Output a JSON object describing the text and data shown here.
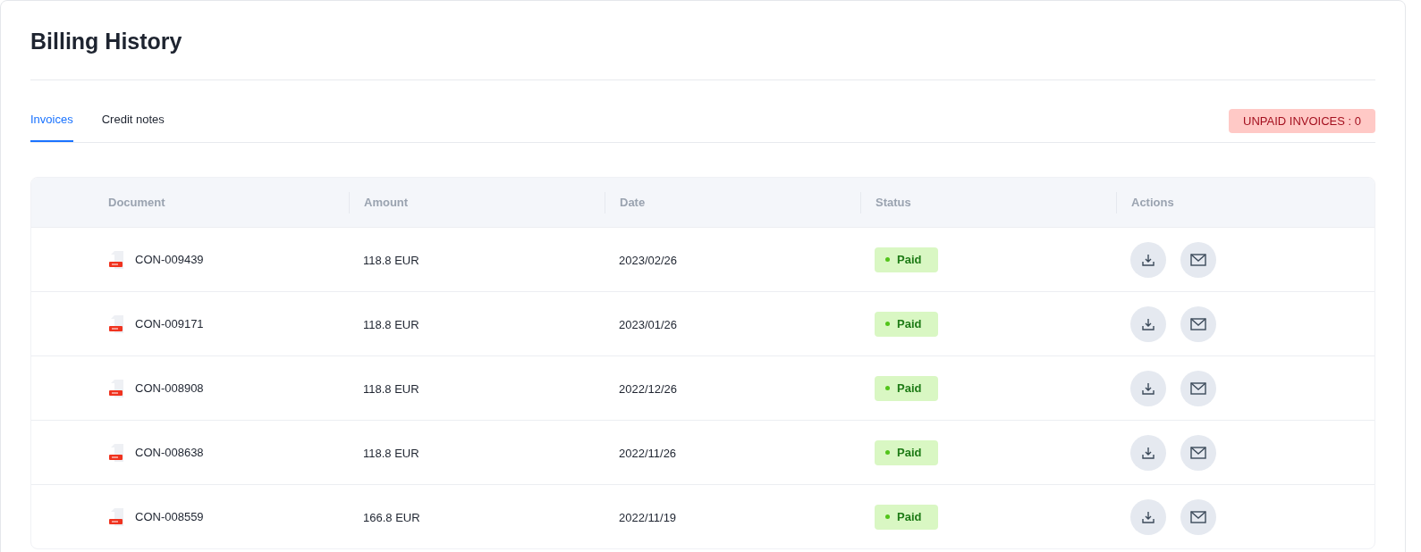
{
  "title": "Billing History",
  "tabs": [
    {
      "label": "Invoices",
      "selected": true
    },
    {
      "label": "Credit notes",
      "selected": false
    }
  ],
  "unpaid_badge": "UNPAID INVOICES : 0",
  "table": {
    "columns": [
      "Document",
      "Amount",
      "Date",
      "Status",
      "Actions"
    ],
    "rows": [
      {
        "document": "CON-009439",
        "amount": "118.8 EUR",
        "date": "2023/02/26",
        "status": "Paid"
      },
      {
        "document": "CON-009171",
        "amount": "118.8 EUR",
        "date": "2023/01/26",
        "status": "Paid"
      },
      {
        "document": "CON-008908",
        "amount": "118.8 EUR",
        "date": "2022/12/26",
        "status": "Paid"
      },
      {
        "document": "CON-008638",
        "amount": "118.8 EUR",
        "date": "2022/11/26",
        "status": "Paid"
      },
      {
        "document": "CON-008559",
        "amount": "166.8 EUR",
        "date": "2022/11/19",
        "status": "Paid"
      }
    ]
  }
}
